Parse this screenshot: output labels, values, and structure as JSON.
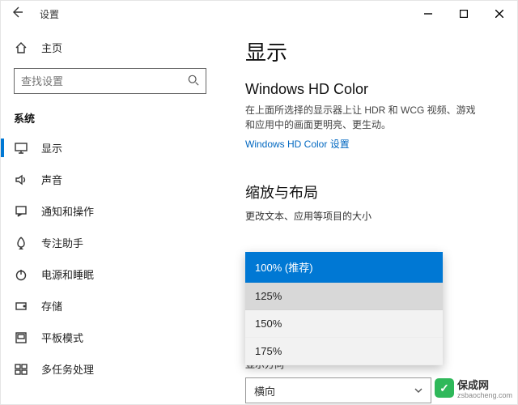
{
  "window": {
    "title": "设置",
    "controls": {
      "min": "—",
      "max": "▢",
      "close": "✕"
    }
  },
  "sidebar": {
    "home": "主页",
    "search_placeholder": "查找设置",
    "category": "系统",
    "items": [
      {
        "label": "显示"
      },
      {
        "label": "声音"
      },
      {
        "label": "通知和操作"
      },
      {
        "label": "专注助手"
      },
      {
        "label": "电源和睡眠"
      },
      {
        "label": "存储"
      },
      {
        "label": "平板模式"
      },
      {
        "label": "多任务处理"
      }
    ]
  },
  "main": {
    "title": "显示",
    "hd_color": {
      "heading": "Windows HD Color",
      "desc": "在上面所选择的显示器上让 HDR 和 WCG 视频、游戏和应用中的画面更明亮、更生动。",
      "link": "Windows HD Color 设置"
    },
    "scale": {
      "heading": "缩放与布局",
      "label": "更改文本、应用等项目的大小",
      "options": [
        "100% (推荐)",
        "125%",
        "150%",
        "175%"
      ],
      "selected": "100% (推荐)"
    },
    "orientation": {
      "label": "显示方向",
      "value": "横向"
    }
  },
  "watermark": {
    "brand": "保成网",
    "url": "zsbaocheng.com",
    "badge": "✓"
  }
}
